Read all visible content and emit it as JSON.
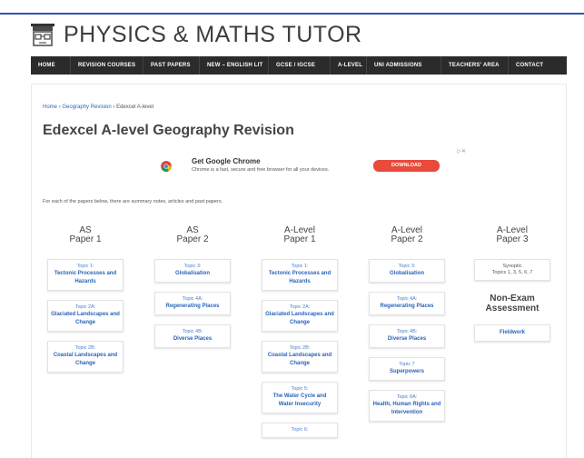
{
  "brand": {
    "name": "PHYSICS & MATHS TUTOR"
  },
  "nav": {
    "items": [
      "HOME",
      "REVISION COURSES",
      "PAST PAPERS",
      "NEW – ENGLISH LIT",
      "GCSE / IGCSE",
      "A-LEVEL",
      "UNI ADMISSIONS",
      "TEACHERS' AREA",
      "CONTACT"
    ]
  },
  "breadcrumb": {
    "home": "Home",
    "section": "Geography Revision",
    "current": "Edexcel A-level",
    "sep": "›"
  },
  "page": {
    "title": "Edexcel A-level Geography Revision",
    "intro": "For each of the papers below, there are summary notes, articles and past papers."
  },
  "ad": {
    "close": "▷✕",
    "title": "Get Google Chrome",
    "description": "Chrome is a fast, secure and free browser for all your devices.",
    "button": "DOWNLOAD"
  },
  "columns": [
    {
      "line1": "AS",
      "line2": "Paper 1",
      "cards": [
        {
          "topic": "Topic 1:",
          "name": "Tectonic Processes and Hazards"
        },
        {
          "topic": "Topic 2A:",
          "name": "Glaciated Landscapes and Change"
        },
        {
          "topic": "Topic 2B:",
          "name": "Coastal Landscapes and Change"
        }
      ]
    },
    {
      "line1": "AS",
      "line2": "Paper 2",
      "cards": [
        {
          "topic": "Topic 3:",
          "name": "Globalisation"
        },
        {
          "topic": "Topic 4A:",
          "name": "Regenerating Places"
        },
        {
          "topic": "Topic 4B:",
          "name": "Diverse Places"
        }
      ]
    },
    {
      "line1": "A-Level",
      "line2": "Paper 1",
      "cards": [
        {
          "topic": "Topic 1:",
          "name": "Tectonic Processes and Hazards"
        },
        {
          "topic": "Topic 2A:",
          "name": "Glaciated Landscapes and Change"
        },
        {
          "topic": "Topic 2B:",
          "name": "Coastal Landscapes and Change"
        },
        {
          "topic": "Topic 5:",
          "name": "The Water Cycle and Water Insecurity"
        },
        {
          "topic": "Topic 6:",
          "name": ""
        }
      ]
    },
    {
      "line1": "A-Level",
      "line2": "Paper 2",
      "cards": [
        {
          "topic": "Topic 3:",
          "name": "Globalisation"
        },
        {
          "topic": "Topic 4A:",
          "name": "Regenerating Places"
        },
        {
          "topic": "Topic 4B:",
          "name": "Diverse Places"
        },
        {
          "topic": "Topic 7",
          "name": "Superpowers"
        },
        {
          "topic": "Topic 8A:",
          "name": "Health, Human Rights and Intervention"
        }
      ]
    },
    {
      "line1": "A-Level",
      "line2": "Paper 3",
      "synoptic_label": "Synoptic",
      "synoptic_topics": "Topics 1, 3, 5, 6, 7",
      "nea_line1": "Non-Exam",
      "nea_line2": "Assessment",
      "fieldwork": "Fieldwork"
    }
  ]
}
